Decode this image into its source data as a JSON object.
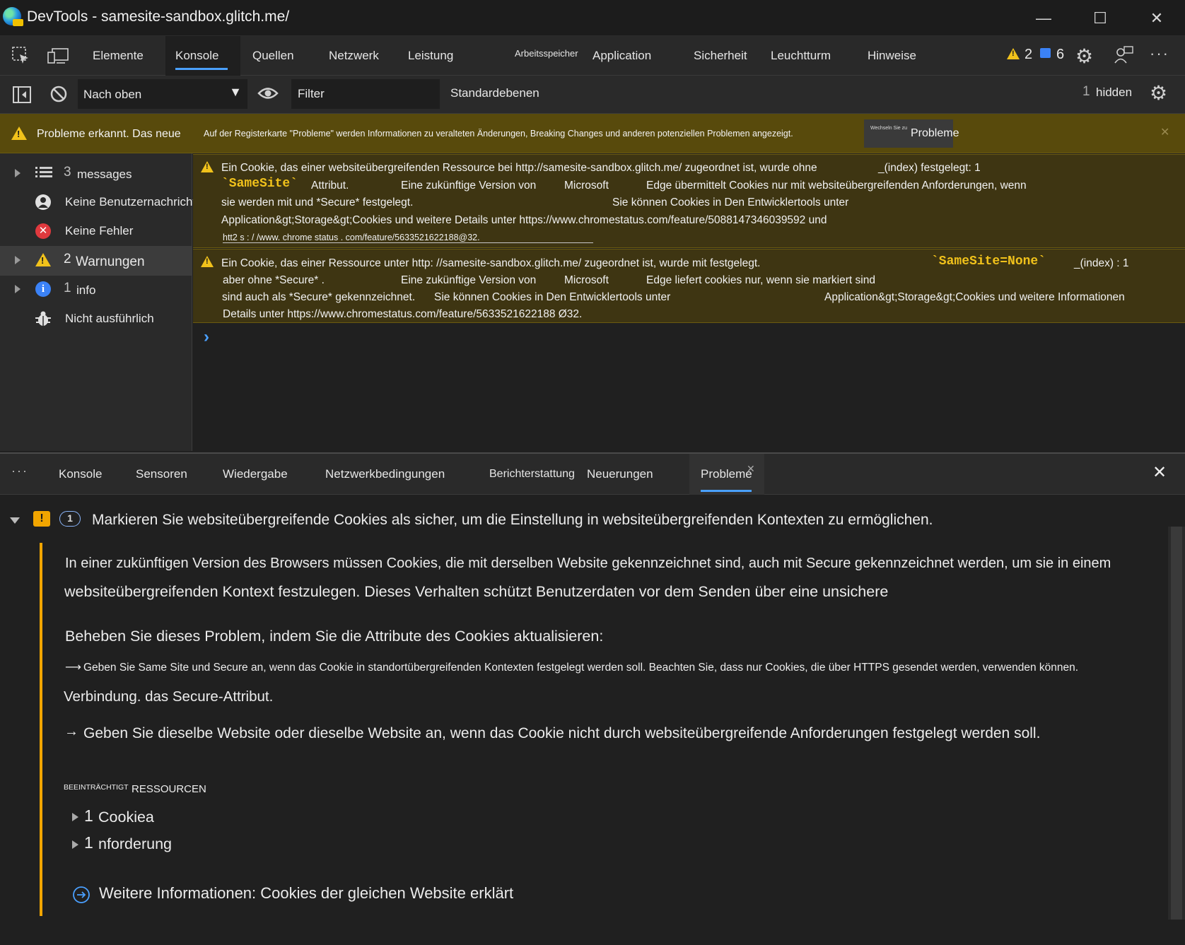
{
  "window": {
    "title": "DevTools - samesite-sandbox.glitch.me/",
    "minimize": "—",
    "maximize": "☐",
    "close": "✕"
  },
  "main_tabs": [
    {
      "label": "Elemente"
    },
    {
      "label": "Konsole"
    },
    {
      "label": "Quellen"
    },
    {
      "label": "Netzwerk"
    },
    {
      "label": "Leistung"
    },
    {
      "label": "Arbeitsspeicher"
    },
    {
      "label": "Application"
    },
    {
      "label": "Sicherheit"
    },
    {
      "label": "Leuchtturm"
    },
    {
      "label": "Hinweise"
    }
  ],
  "counters": {
    "warnings": "2",
    "messages": "6"
  },
  "toolbar": {
    "context": "Nach oben",
    "filter_placeholder": "Filter",
    "levels": "Standardebenen",
    "hidden_count": "1",
    "hidden_label": "hidden"
  },
  "banner": {
    "title": "Probleme erkannt. Das neue",
    "text": "Auf der Registerkarte \"Probleme\" werden Informationen zu veralteten Änderungen, Breaking Changes und anderen potenziellen Problemen angezeigt.",
    "button_small": "Wechseln Sie zu",
    "button_label": "Probleme",
    "close": "✕"
  },
  "sidebar": {
    "items": [
      {
        "count": "3",
        "label": "messages"
      },
      {
        "label": "Keine Benutzernachrichten"
      },
      {
        "label": "Keine Fehler"
      },
      {
        "count": "2",
        "label": "Warnungen"
      },
      {
        "count": "1",
        "label": "info"
      },
      {
        "label": "Nicht ausführlich"
      }
    ]
  },
  "messages": [
    {
      "line1": "Ein Cookie, das einer websiteübergreifenden Ressource bei http://samesite-sandbox.glitch.me/ zugeordnet ist, wurde ohne",
      "source": "_(index) festgelegt: 1",
      "code": "`SameSite`",
      "l2a": "Attribut.",
      "l2b": "Eine zukünftige Version von",
      "l2c": "Microsoft",
      "l2d": "Edge übermittelt Cookies nur mit websiteübergreifenden Anforderungen, wenn",
      "l3a": "sie werden mit und *Secure* festgelegt.",
      "l3b": "Sie können Cookies in Den Entwicklertools unter",
      "l4": "Application&gt;Storage&gt;Cookies  und weitere  Details  unter  https://www.chromestatus.com/feature/5088147346039592  und",
      "l5": "htt2 s : / /www. chrome status . com/feature/5633521622188@32."
    },
    {
      "line1": "Ein Cookie, das einer Ressource unter http: //samesite-sandbox.glitch.me/ zugeordnet ist, wurde mit festgelegt.",
      "code": "`SameSite=None`",
      "source": "_(index) : 1",
      "l2a": "aber ohne *Secure* .",
      "l2b": "Eine zukünftige Version von",
      "l2c": "Microsoft",
      "l2d": "Edge liefert cookies nur, wenn sie markiert sind",
      "l3a": "sind auch als *Secure* gekennzeichnet.",
      "l3b": "Sie können Cookies in Den Entwicklertools unter",
      "l3c": "Application&gt;Storage&gt;Cookies und weitere Informationen",
      "l4": "Details unter https://www.chromestatus.com/feature/5633521622188 Ø32."
    }
  ],
  "prompt": "›",
  "drawer_tabs": [
    {
      "label": "Konsole"
    },
    {
      "label": "Sensoren"
    },
    {
      "label": "Wiedergabe"
    },
    {
      "label": "Netzwerkbedingungen"
    },
    {
      "label": "Berichterstattung"
    },
    {
      "label": "Neuerungen"
    },
    {
      "label": "Probleme"
    }
  ],
  "issue": {
    "count": "1",
    "title": "Markieren Sie websiteübergreifende Cookies als sicher, um die Einstellung in websiteübergreifenden Kontexten zu ermöglichen.",
    "para1_line1": "In einer zukünftigen Version des Browsers müssen Cookies, die mit derselben Website gekennzeichnet sind, auch mit Secure gekennzeichnet werden, um sie in einem",
    "para1_line2": "websiteübergreifenden Kontext festzulegen. Dieses Verhalten schützt Benutzerdaten vor dem Senden über eine unsichere",
    "fix_heading": "Beheben Sie dieses Problem, indem Sie die Attribute des Cookies aktualisieren:",
    "bullet1": "Geben Sie Same Site und Secure an, wenn das Cookie in standortübergreifenden Kontexten festgelegt werden soll. Beachten Sie, dass nur Cookies, die über HTTPS gesendet werden, verwenden können.",
    "bullet1_cont": "Verbindung. das Secure-Attribut.",
    "bullet2": "Geben Sie dieselbe Website oder dieselbe Website an, wenn das Cookie nicht durch websiteübergreifende Anforderungen festgelegt werden soll.",
    "affected_small": "BEEINTRÄCHTIGT",
    "affected_label": "RESSOURCEN",
    "resources": [
      {
        "count": "1",
        "label": "Cookiea"
      },
      {
        "count": "1",
        "label": "nforderung"
      }
    ],
    "learn_more": "Weitere Informationen: Cookies der gleichen Website erklärt"
  }
}
